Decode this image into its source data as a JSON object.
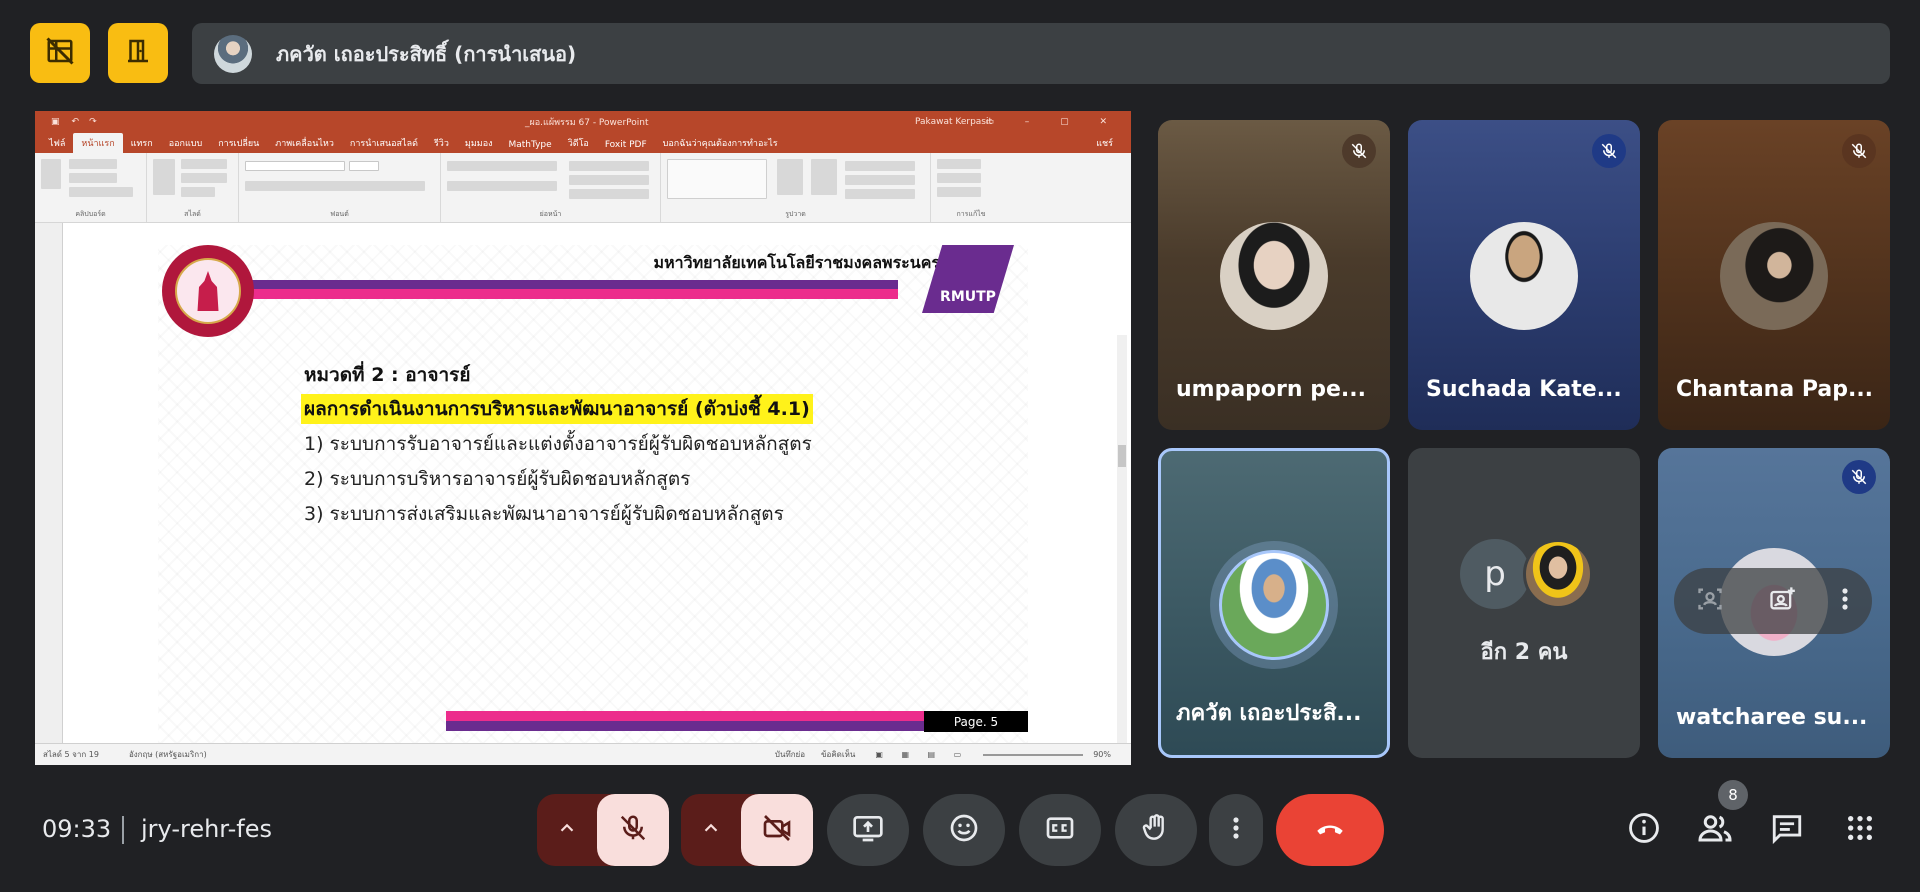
{
  "top": {
    "presenter_name": "ภควัต เถอะประสิทธิ์ (การนำเสนอ)"
  },
  "powerpoint": {
    "window_title": "_ผอ.แผ้พรรม 67  -  PowerPoint",
    "user_name": "Pakawat Kerpasit",
    "tabs": [
      "ไฟล์",
      "หน้าแรก",
      "แทรก",
      "ออกแบบ",
      "การเปลี่ยน",
      "ภาพเคลื่อนไหว",
      "การนำเสนอสไลด์",
      "รีวิว",
      "มุมมอง",
      "MathType",
      "วิดีโอ",
      "Foxit PDF",
      "บอกฉันว่าคุณต้องการทำอะไร"
    ],
    "share_label": "แชร์",
    "ribbon_groups": [
      "คลิปบอร์ด",
      "สไลด์",
      "ฟอนต์",
      "ย่อหน้า",
      "รูปวาด",
      "การแก้ไข"
    ],
    "status_left": "สไลด์ 5 จาก 19",
    "status_lang": "อังกฤษ (สหรัฐอเมริกา)",
    "status_notes": "บันทึกย่อ",
    "status_comments": "ข้อคิดเห็น",
    "zoom": "90%"
  },
  "slide": {
    "university": "มหาวิทยาลัยเทคโนโลยีราชมงคลพระนคร",
    "logo_text": "RMUTP",
    "heading": "หมวดที่ 2 : อาจารย์",
    "highlight": "ผลการดำเนินงานการบริหารและพัฒนาอาจารย์ (ตัวบ่งชี้ 4.1)",
    "items": [
      "1) ระบบการรับอาจารย์และแต่งตั้งอาจารย์ผู้รับผิดชอบหลักสูตร",
      "2) ระบบการบริหารอาจารย์ผู้รับผิดชอบหลักสูตร",
      "3) ระบบการส่งเสริมและพัฒนาอาจารย์ผู้รับผิดชอบหลักสูตร"
    ],
    "page": "Page. 5"
  },
  "participants": [
    {
      "name": "umpaporn pe...",
      "muted": true
    },
    {
      "name": "Suchada Kate...",
      "muted": true
    },
    {
      "name": "Chantana Pap...",
      "muted": true
    },
    {
      "name": "ภควัต เถอะประสิ...",
      "muted": false,
      "speaking": true
    },
    {
      "name": "อีก 2 คน",
      "initial": "p"
    },
    {
      "name": "watcharee su...",
      "muted": true
    }
  ],
  "bottom": {
    "time": "09:33",
    "meeting_code": "jry-rehr-fes",
    "people_count": "8"
  },
  "colors": {
    "background": "#202124",
    "accent_yellow": "#f9bd12",
    "hangup_red": "#ea4335",
    "muted_light": "#f9dedc",
    "muted_dark": "#5b1d1a",
    "ppt_orange": "#b7472a",
    "slide_pink": "#ec2d8c",
    "slide_purple": "#6a2c8f"
  }
}
